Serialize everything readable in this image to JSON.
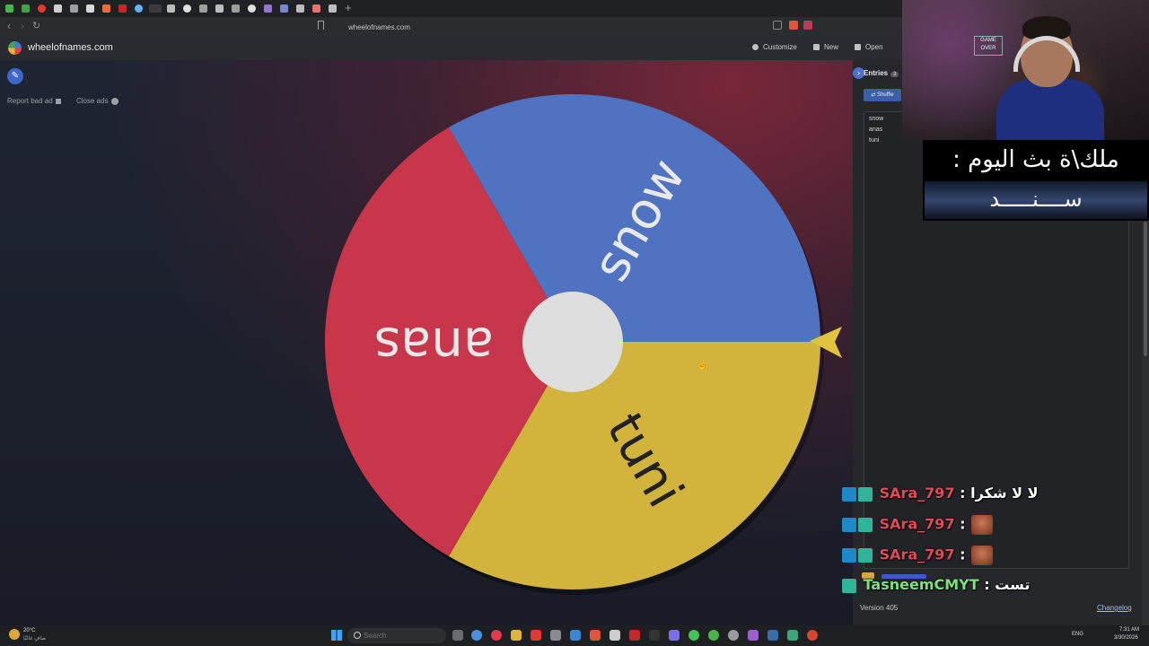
{
  "browser": {
    "url": "wheelofnames.com",
    "new_tab_symbol": "+"
  },
  "header": {
    "site_title": "wheelofnames.com",
    "customize_label": "Customize",
    "new_label": "New",
    "open_label": "Open"
  },
  "ads": {
    "report_label": "Report bad ad",
    "close_label": "Close ads"
  },
  "wheel": {
    "segments": [
      {
        "label": "snow",
        "color": "#4f73c0"
      },
      {
        "label": "tuni",
        "color": "#d2b33c"
      },
      {
        "label": "anas",
        "color": "#c7364a"
      }
    ],
    "hub_color": "#dedede",
    "pointer_color": "#e0c23e"
  },
  "sidebar": {
    "entries_tab": "Entries",
    "entries_count": "3",
    "shuffle_label": "Shuffle",
    "entries": [
      "snow",
      "anas",
      "tuni"
    ],
    "version": "Version 405",
    "changelog": "Changelog"
  },
  "stream": {
    "webcam_sign": "GAME OVER",
    "banner_title": "ملك\\ة بث اليوم :",
    "banner_name": "ســــنـــــد"
  },
  "chat": [
    {
      "user": "SAra_797",
      "message": "لا لا شكرا",
      "emote": false
    },
    {
      "user": "SAra_797",
      "message": "",
      "emote": true
    },
    {
      "user": "SAra_797",
      "message": "",
      "emote": true
    },
    {
      "user": "TasneemCMYT",
      "message": "تست",
      "emote": false
    }
  ],
  "taskbar": {
    "weather_temp": "20°C",
    "weather_desc": "صافٍ غالبًا",
    "search_placeholder": "Search",
    "language": "ENG",
    "time": "7:31 AM",
    "date": "3/30/2026"
  }
}
